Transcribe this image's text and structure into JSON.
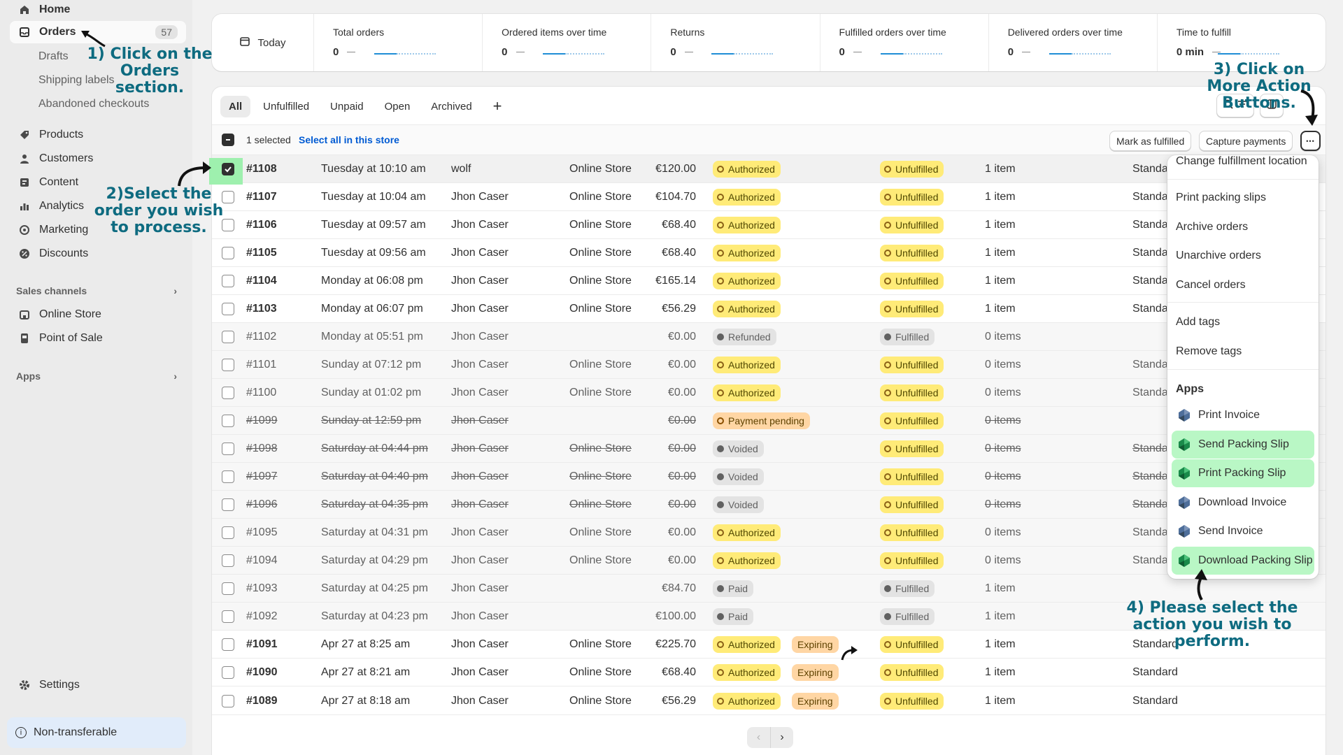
{
  "sidebar": {
    "home": "Home",
    "orders": "Orders",
    "orders_count": "57",
    "drafts": "Drafts",
    "shipping_labels": "Shipping labels",
    "abandoned": "Abandoned checkouts",
    "products": "Products",
    "customers": "Customers",
    "content": "Content",
    "analytics": "Analytics",
    "marketing": "Marketing",
    "discounts": "Discounts",
    "sales_channels": "Sales channels",
    "online_store": "Online Store",
    "pos": "Point of Sale",
    "apps": "Apps",
    "settings": "Settings",
    "non_transferable": "Non-transferable"
  },
  "stats": {
    "today": "Today",
    "items": [
      {
        "label": "Total orders",
        "value": "0"
      },
      {
        "label": "Ordered items over time",
        "value": "0"
      },
      {
        "label": "Returns",
        "value": "0"
      },
      {
        "label": "Fulfilled orders over time",
        "value": "0"
      },
      {
        "label": "Delivered orders over time",
        "value": "0"
      },
      {
        "label": "Time to fulfill",
        "value": "0 min"
      }
    ]
  },
  "tabs": [
    "All",
    "Unfulfilled",
    "Unpaid",
    "Open",
    "Archived",
    "+"
  ],
  "bulk": {
    "selected": "1 selected",
    "select_all": "Select all in this store",
    "mark_fulfilled": "Mark as fulfilled",
    "capture": "Capture payments",
    "more": "•••"
  },
  "orders": [
    {
      "num": "#1108",
      "date": "Tuesday at 10:10 am",
      "cust": "wolf",
      "chan": "Online Store",
      "total": "€120.00",
      "pay": "Authorized",
      "exp": "",
      "ful": "Unfulfilled",
      "items": "1 item",
      "del": "Standa"
    },
    {
      "num": "#1107",
      "date": "Tuesday at 10:04 am",
      "cust": "Jhon Caser",
      "chan": "Online Store",
      "total": "€104.70",
      "pay": "Authorized",
      "exp": "",
      "ful": "Unfulfilled",
      "items": "1 item",
      "del": "Standa"
    },
    {
      "num": "#1106",
      "date": "Tuesday at 09:57 am",
      "cust": "Jhon Caser",
      "chan": "Online Store",
      "total": "€68.40",
      "pay": "Authorized",
      "exp": "",
      "ful": "Unfulfilled",
      "items": "1 item",
      "del": "Standa"
    },
    {
      "num": "#1105",
      "date": "Tuesday at 09:56 am",
      "cust": "Jhon Caser",
      "chan": "Online Store",
      "total": "€68.40",
      "pay": "Authorized",
      "exp": "",
      "ful": "Unfulfilled",
      "items": "1 item",
      "del": "Standa"
    },
    {
      "num": "#1104",
      "date": "Monday at 06:08 pm",
      "cust": "Jhon Caser",
      "chan": "Online Store",
      "total": "€165.14",
      "pay": "Authorized",
      "exp": "",
      "ful": "Unfulfilled",
      "items": "1 item",
      "del": "Standa"
    },
    {
      "num": "#1103",
      "date": "Monday at 06:07 pm",
      "cust": "Jhon Caser",
      "chan": "Online Store",
      "total": "€56.29",
      "pay": "Authorized",
      "exp": "",
      "ful": "Unfulfilled",
      "items": "1 item",
      "del": "Standa"
    },
    {
      "num": "#1102",
      "date": "Monday at 05:51 pm",
      "cust": "Jhon Caser",
      "chan": "",
      "total": "€0.00",
      "pay": "Refunded",
      "exp": "",
      "ful": "Fulfilled",
      "items": "0 items",
      "del": ""
    },
    {
      "num": "#1101",
      "date": "Sunday at 07:12 pm",
      "cust": "Jhon Caser",
      "chan": "Online Store",
      "total": "€0.00",
      "pay": "Authorized",
      "exp": "",
      "ful": "Unfulfilled",
      "items": "0 items",
      "del": "Standa"
    },
    {
      "num": "#1100",
      "date": "Sunday at 01:02 pm",
      "cust": "Jhon Caser",
      "chan": "Online Store",
      "total": "€0.00",
      "pay": "Authorized",
      "exp": "",
      "ful": "Unfulfilled",
      "items": "0 items",
      "del": "Standa"
    },
    {
      "num": "#1099",
      "date": "Sunday at 12:59 pm",
      "cust": "Jhon Caser",
      "chan": "",
      "total": "€0.00",
      "pay": "Payment pending",
      "exp": "",
      "ful": "Unfulfilled",
      "items": "0 items",
      "del": ""
    },
    {
      "num": "#1098",
      "date": "Saturday at 04:44 pm",
      "cust": "Jhon Caser",
      "chan": "Online Store",
      "total": "€0.00",
      "pay": "Voided",
      "exp": "",
      "ful": "Unfulfilled",
      "items": "0 items",
      "del": "Standa"
    },
    {
      "num": "#1097",
      "date": "Saturday at 04:40 pm",
      "cust": "Jhon Caser",
      "chan": "Online Store",
      "total": "€0.00",
      "pay": "Voided",
      "exp": "",
      "ful": "Unfulfilled",
      "items": "0 items",
      "del": "Standa"
    },
    {
      "num": "#1096",
      "date": "Saturday at 04:35 pm",
      "cust": "Jhon Caser",
      "chan": "Online Store",
      "total": "€0.00",
      "pay": "Voided",
      "exp": "",
      "ful": "Unfulfilled",
      "items": "0 items",
      "del": "Standa"
    },
    {
      "num": "#1095",
      "date": "Saturday at 04:31 pm",
      "cust": "Jhon Caser",
      "chan": "Online Store",
      "total": "€0.00",
      "pay": "Authorized",
      "exp": "",
      "ful": "Unfulfilled",
      "items": "0 items",
      "del": "Standa"
    },
    {
      "num": "#1094",
      "date": "Saturday at 04:29 pm",
      "cust": "Jhon Caser",
      "chan": "Online Store",
      "total": "€0.00",
      "pay": "Authorized",
      "exp": "",
      "ful": "Unfulfilled",
      "items": "0 items",
      "del": "Standa"
    },
    {
      "num": "#1093",
      "date": "Saturday at 04:25 pm",
      "cust": "Jhon Caser",
      "chan": "",
      "total": "€84.70",
      "pay": "Paid",
      "exp": "",
      "ful": "Fulfilled",
      "items": "1 item",
      "del": ""
    },
    {
      "num": "#1092",
      "date": "Saturday at 04:23 pm",
      "cust": "Jhon Caser",
      "chan": "",
      "total": "€100.00",
      "pay": "Paid",
      "exp": "",
      "ful": "Fulfilled",
      "items": "1 item",
      "del": ""
    },
    {
      "num": "#1091",
      "date": "Apr 27 at 8:25 am",
      "cust": "Jhon Caser",
      "chan": "Online Store",
      "total": "€225.70",
      "pay": "Authorized",
      "exp": "Expiring",
      "ful": "Unfulfilled",
      "items": "1 item",
      "del": "Standard"
    },
    {
      "num": "#1090",
      "date": "Apr 27 at 8:21 am",
      "cust": "Jhon Caser",
      "chan": "Online Store",
      "total": "€68.40",
      "pay": "Authorized",
      "exp": "Expiring",
      "ful": "Unfulfilled",
      "items": "1 item",
      "del": "Standard"
    },
    {
      "num": "#1089",
      "date": "Apr 27 at 8:18 am",
      "cust": "Jhon Caser",
      "chan": "Online Store",
      "total": "€56.29",
      "pay": "Authorized",
      "exp": "Expiring",
      "ful": "Unfulfilled",
      "items": "1 item",
      "del": "Standard"
    }
  ],
  "menu": {
    "change_location": "Change fulfillment location",
    "print_slips": "Print packing slips",
    "archive": "Archive orders",
    "unarchive": "Unarchive orders",
    "cancel": "Cancel orders",
    "add_tags": "Add tags",
    "remove_tags": "Remove tags",
    "apps_header": "Apps",
    "apps": [
      "Print Invoice",
      "Send Packing Slip",
      "Print Packing Slip",
      "Download Invoice",
      "Send Invoice",
      "Download Packing Slip"
    ]
  },
  "annotations": {
    "step1": "1) Click on the Orders section.",
    "step2": "2)Select the order you wish to process.",
    "step3": "3) Click on More Action Buttons.",
    "step4": "4) Please select the action you wish to perform."
  },
  "colors": {
    "annotation": "#0e6b80",
    "highlight": "#b9f7c5",
    "authorized_badge": "#ffeb78",
    "expiring_badge": "#ffd6a4"
  }
}
